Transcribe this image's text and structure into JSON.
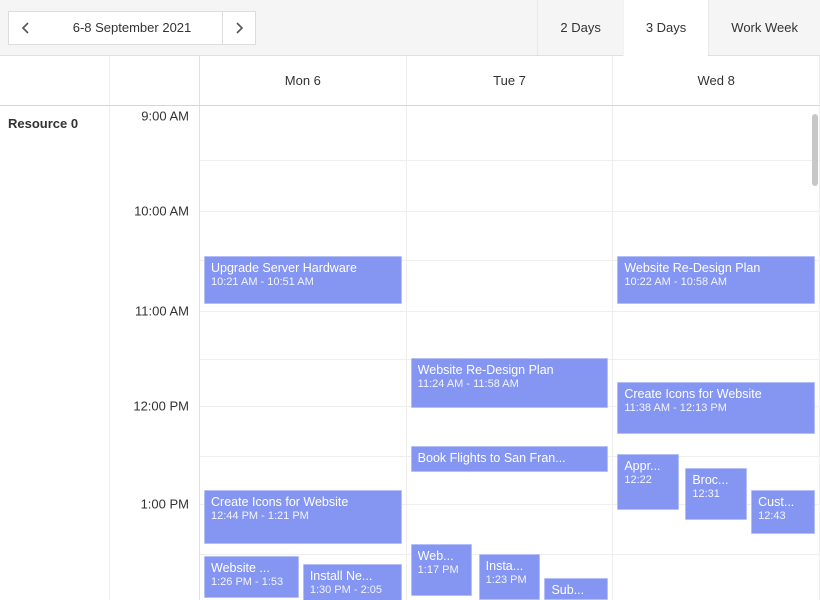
{
  "toolbar": {
    "date_range": "6-8 September 2021",
    "views": [
      {
        "label": "2 Days",
        "active": false
      },
      {
        "label": "3 Days",
        "active": true
      },
      {
        "label": "Work Week",
        "active": false
      }
    ]
  },
  "resource_label": "Resource 0",
  "day_headers": [
    "Mon 6",
    "Tue 7",
    "Wed 8"
  ],
  "time_slots": [
    "9:00 AM",
    "10:00 AM",
    "11:00 AM",
    "12:00 PM",
    "1:00 PM"
  ],
  "events": {
    "mon": [
      {
        "title": "Upgrade Server Hardware",
        "time": "10:21 AM - 10:51 AM"
      },
      {
        "title": "Create Icons for Website",
        "time": "12:44 PM - 1:21 PM"
      },
      {
        "title": "Website ...",
        "time": "1:26 PM - 1:53"
      },
      {
        "title": "Install Ne...",
        "time": "1:30 PM - 2:05"
      }
    ],
    "tue": [
      {
        "title": "Website Re-Design Plan",
        "time": "11:24 AM - 11:58 AM"
      },
      {
        "title": "Book Flights to San Fran...",
        "time": ""
      },
      {
        "title": "Web...",
        "time": "1:17 PM"
      },
      {
        "title": "Insta...",
        "time": "1:23 PM"
      },
      {
        "title": "Sub...",
        "time": ""
      }
    ],
    "wed": [
      {
        "title": "Website Re-Design Plan",
        "time": "10:22 AM - 10:58 AM"
      },
      {
        "title": "Create Icons for Website",
        "time": "11:38 AM - 12:13 PM"
      },
      {
        "title": "Appr...",
        "time": "12:22"
      },
      {
        "title": "Broc...",
        "time": "12:31"
      },
      {
        "title": "Cust...",
        "time": "12:43"
      }
    ]
  }
}
